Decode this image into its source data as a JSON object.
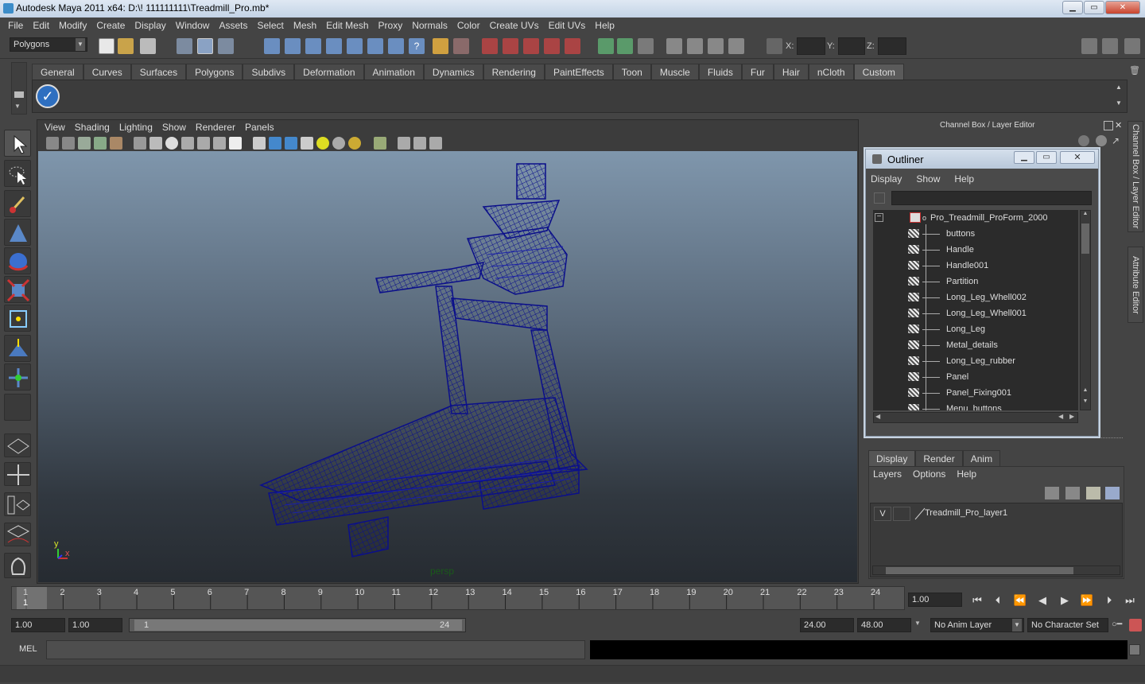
{
  "window": {
    "title": "Autodesk Maya 2011 x64: D:\\! 111111111\\Treadmill_Pro.mb*"
  },
  "menubar": [
    "File",
    "Edit",
    "Modify",
    "Create",
    "Display",
    "Window",
    "Assets",
    "Select",
    "Mesh",
    "Edit Mesh",
    "Proxy",
    "Normals",
    "Color",
    "Create UVs",
    "Edit UVs",
    "Help"
  ],
  "status": {
    "mode": "Polygons",
    "x_label": "X:",
    "y_label": "Y:",
    "z_label": "Z:"
  },
  "shelf": {
    "tabs": [
      "General",
      "Curves",
      "Surfaces",
      "Polygons",
      "Subdivs",
      "Deformation",
      "Animation",
      "Dynamics",
      "Rendering",
      "PaintEffects",
      "Toon",
      "Muscle",
      "Fluids",
      "Fur",
      "Hair",
      "nCloth",
      "Custom"
    ],
    "active": "Custom"
  },
  "viewport": {
    "menu": [
      "View",
      "Shading",
      "Lighting",
      "Show",
      "Renderer",
      "Panels"
    ],
    "camera_label": "persp",
    "axis_y": "y",
    "axis_x": "x"
  },
  "channel_box": {
    "title": "Channel Box / Layer Editor"
  },
  "side_tabs": {
    "channel": "Channel Box / Layer Editor",
    "attribute": "Attribute Editor"
  },
  "outliner": {
    "title": "Outliner",
    "menu": [
      "Display",
      "Show",
      "Help"
    ],
    "root": "Pro_Treadmill_ProForm_2000",
    "items": [
      "buttons",
      "Handle",
      "Handle001",
      "Partition",
      "Long_Leg_Whell002",
      "Long_Leg_Whell001",
      "Long_Leg",
      "Metal_details",
      "Long_Leg_rubber",
      "Panel",
      "Panel_Fixing001",
      "Menu_buttons"
    ]
  },
  "layer_editor": {
    "tabs": [
      "Display",
      "Render",
      "Anim"
    ],
    "active": "Display",
    "menu": [
      "Layers",
      "Options",
      "Help"
    ],
    "layer": {
      "visibility": "V",
      "name": "Treadmill_Pro_layer1"
    }
  },
  "timeline": {
    "ticks": [
      "1",
      "2",
      "3",
      "4",
      "5",
      "6",
      "7",
      "8",
      "9",
      "10",
      "11",
      "12",
      "13",
      "14",
      "15",
      "16",
      "17",
      "18",
      "19",
      "20",
      "21",
      "22",
      "23",
      "24"
    ],
    "current_frame": "1",
    "current_time_field": "1.00"
  },
  "range": {
    "start_field": "1.00",
    "playback_start": "1.00",
    "range_start_label": "1",
    "range_end_label": "24",
    "playback_end": "24.00",
    "end_field": "48.00",
    "anim_layer": "No Anim Layer",
    "character_set": "No Character Set"
  },
  "command_line": {
    "label": "MEL"
  },
  "colors": {
    "wireframe": "#0b0f8a",
    "accent": "#c7d3e0",
    "background": "#444444"
  }
}
